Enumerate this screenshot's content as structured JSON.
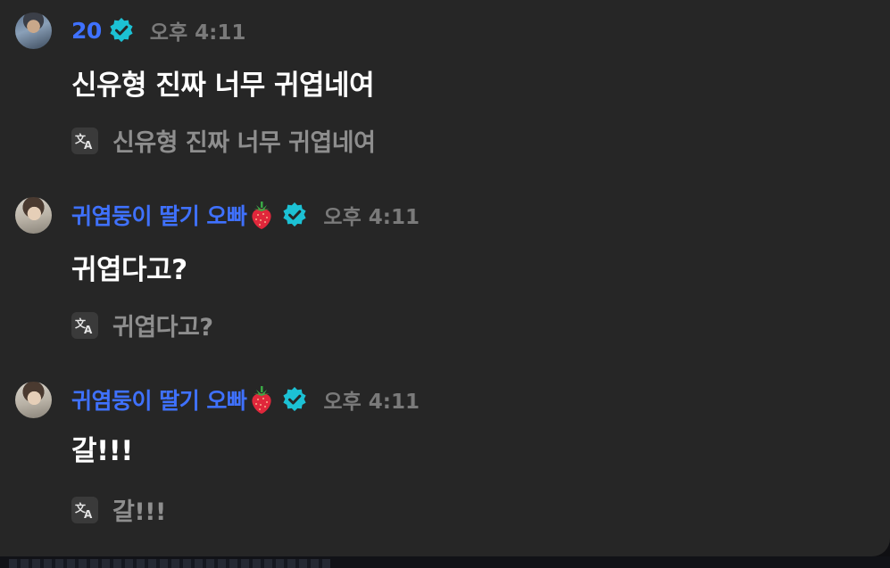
{
  "messages": [
    {
      "username": "20",
      "has_strawberry": false,
      "timestamp": "오후 4:11",
      "text": "신유형 진짜 너무 귀엽네여",
      "translation": "신유형 진짜 너무 귀엽네여",
      "avatar_icon": "user-avatar"
    },
    {
      "username": "귀염둥이 딸기 오빠",
      "has_strawberry": true,
      "timestamp": "오후 4:11",
      "text": "귀엽다고?",
      "translation": "귀엽다고?",
      "avatar_icon": "user-avatar"
    },
    {
      "username": "귀염둥이 딸기 오빠",
      "has_strawberry": true,
      "timestamp": "오후 4:11",
      "text": "갈!!!",
      "translation": "갈!!!",
      "avatar_icon": "user-avatar"
    }
  ],
  "colors": {
    "username": "#3f71ff",
    "verified_badge": "#1cc1d4",
    "panel_background": "#262626",
    "timestamp": "#7a7a7a",
    "message_text": "#ffffff",
    "translation_text": "#8e8e8e"
  },
  "icons": {
    "verified": "verified-check-icon",
    "translate": "translate-icon",
    "strawberry": "strawberry-emoji"
  }
}
